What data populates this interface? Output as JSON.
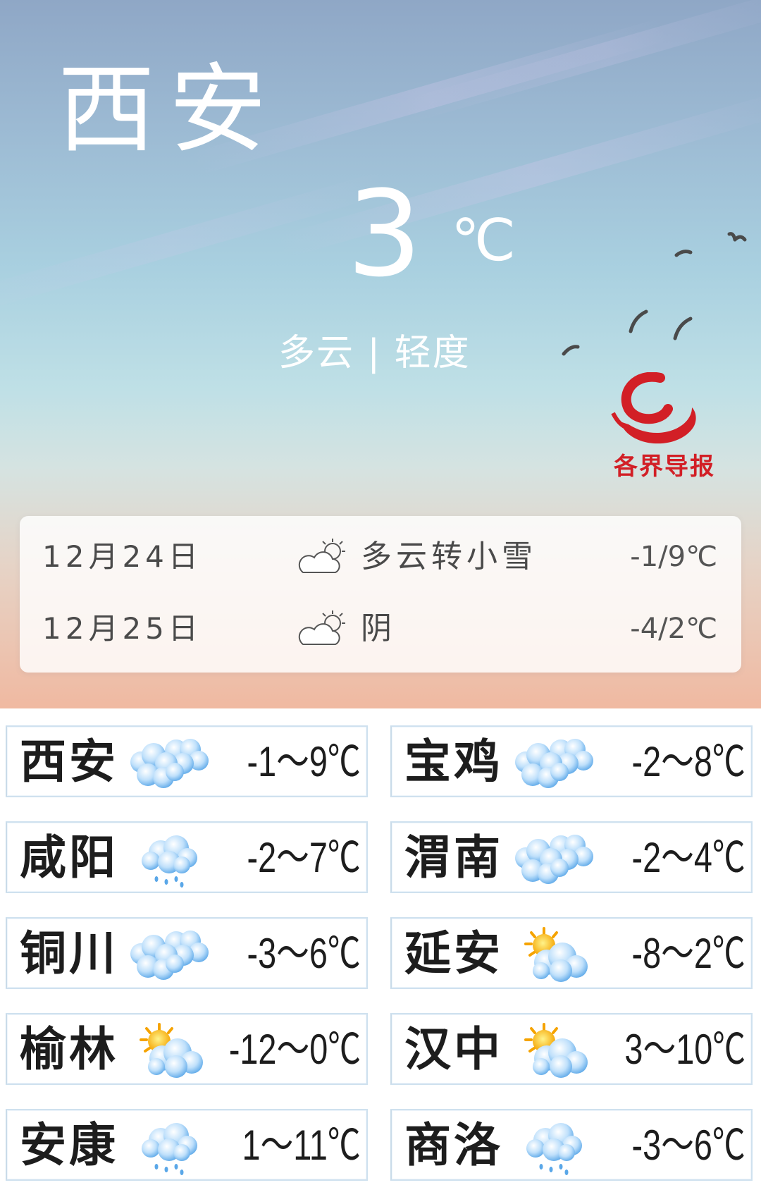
{
  "header": {
    "city": "西安",
    "temperature": "3",
    "unit": "℃",
    "condition": "多云 | 轻度",
    "logo_text": "各界导报"
  },
  "forecast": [
    {
      "date": "12月24日",
      "icon": "partly-cloudy-icon",
      "desc": "多云转小雪",
      "temp": "-1/9℃"
    },
    {
      "date": "12月25日",
      "icon": "partly-cloudy-icon",
      "desc": "阴",
      "temp": "-4/2℃"
    }
  ],
  "cities": [
    {
      "name": "西安",
      "icon": "cloudy-icon",
      "range": "-1～9℃"
    },
    {
      "name": "宝鸡",
      "icon": "cloudy-icon",
      "range": "-2～8℃"
    },
    {
      "name": "咸阳",
      "icon": "light-rain-icon",
      "range": "-2～7℃"
    },
    {
      "name": "渭南",
      "icon": "cloudy-icon",
      "range": "-2～4℃"
    },
    {
      "name": "铜川",
      "icon": "cloudy-icon",
      "range": "-3～6℃"
    },
    {
      "name": "延安",
      "icon": "sun-behind-cloud-icon",
      "range": "-8～2℃"
    },
    {
      "name": "榆林",
      "icon": "sun-behind-cloud-icon",
      "range": "-12～0℃"
    },
    {
      "name": "汉中",
      "icon": "sun-behind-cloud-icon",
      "range": "3～10℃"
    },
    {
      "name": "安康",
      "icon": "light-rain-icon",
      "range": "1～11℃"
    },
    {
      "name": "商洛",
      "icon": "light-rain-icon",
      "range": "-3～6℃"
    }
  ],
  "colors": {
    "sky_top": "#8fa7c6",
    "sky_bottom": "#f0b9a1",
    "logo_red": "#d21f26",
    "card_border": "#cfe1ef"
  }
}
